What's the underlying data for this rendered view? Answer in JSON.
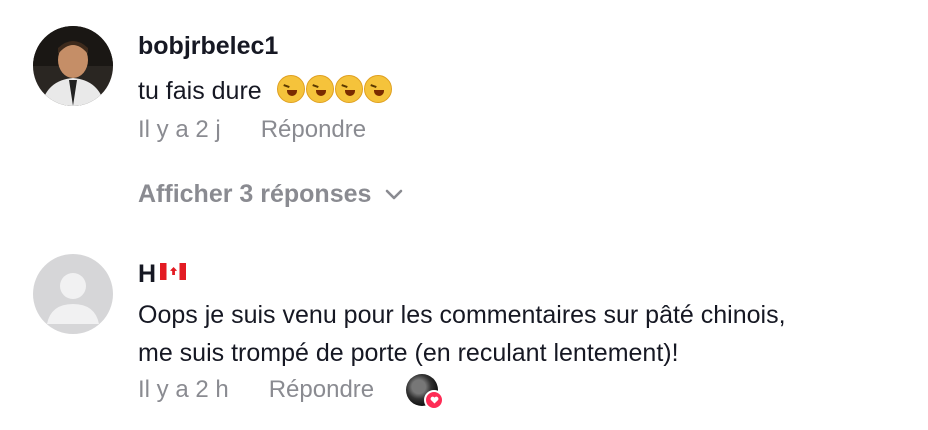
{
  "comments": [
    {
      "username": "bobjrbelec1",
      "text": "tu fais dure",
      "emoji_count": 4,
      "timestamp": "Il y a 2 j",
      "reply_label": "Répondre",
      "view_replies_label": "Afficher 3 réponses"
    },
    {
      "username": "H",
      "flag": "canada-flag-icon",
      "text_line1": "Oops je suis venu pour les commentaires sur pâté chinois,",
      "text_line2": "me suis trompé de porte (en reculant lentement)!",
      "timestamp": "Il y a 2 h",
      "reply_label": "Répondre",
      "liked_by_creator": true
    }
  ],
  "colors": {
    "text": "#161823",
    "muted": "#8a8b91",
    "heart": "#fe2c55"
  }
}
